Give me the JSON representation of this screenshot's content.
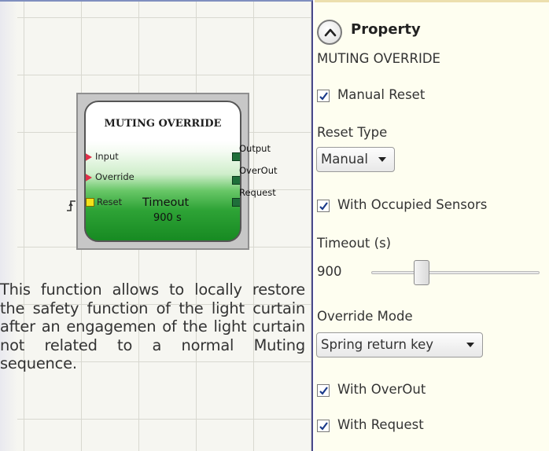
{
  "block": {
    "title": "MUTING OVERRIDE",
    "inputs": [
      "Input",
      "Override",
      "Reset"
    ],
    "outputs": [
      "Output",
      "OverOut",
      "Request"
    ],
    "timeout_label": "Timeout",
    "timeout_value": "900 s"
  },
  "description": "This function allows to locally restore the safety function of the light curtain after an engagemen of the light curtain not related to a normal Muting sequence.",
  "panel": {
    "title": "Property",
    "subtitle": "MUTING OVERRIDE",
    "manual_reset": {
      "label": "Manual Reset",
      "checked": true
    },
    "reset_type": {
      "label": "Reset Type",
      "value": "Manual"
    },
    "occupied_sensors": {
      "label": "With Occupied Sensors",
      "checked": true
    },
    "timeout": {
      "label": "Timeout (s)",
      "value": "900",
      "slider_fraction": 0.28
    },
    "override_mode": {
      "label": "Override Mode",
      "value": "Spring return key"
    },
    "with_overout": {
      "label": "With OverOut",
      "checked": true
    },
    "with_request": {
      "label": "With Request",
      "checked": true
    }
  },
  "icons": {
    "collapse": "chevron-up-circle-icon",
    "checkbox": "checkmark-icon",
    "dropdown": "chevron-down-icon",
    "edge": "rising-edge-icon"
  },
  "colors": {
    "block_green": "#2ea336",
    "input_pin": "#e0304a",
    "reset_pin": "#f4e21a",
    "output_pin": "#1f6f3a",
    "panel_bg": "#fefef0"
  }
}
